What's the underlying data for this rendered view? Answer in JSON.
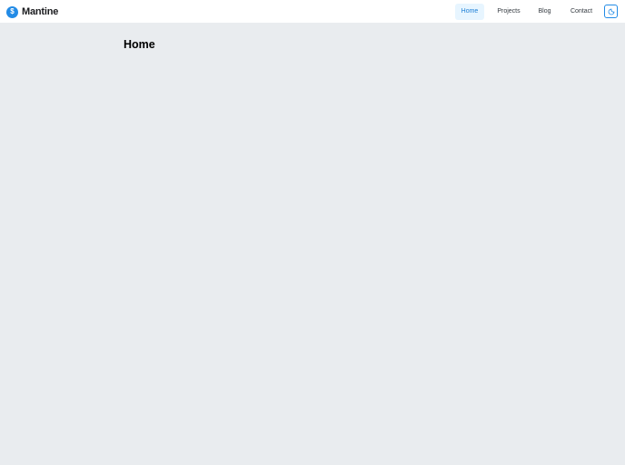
{
  "header": {
    "logo": {
      "mark_icon": "mantine-logo-icon",
      "brand_name": "Mantine"
    },
    "nav": {
      "items": [
        {
          "label": "Home",
          "active": true
        },
        {
          "label": "Projects",
          "active": false
        },
        {
          "label": "Blog",
          "active": false
        },
        {
          "label": "Contact",
          "active": false
        }
      ]
    },
    "theme_toggle": {
      "icon": "moon-icon"
    }
  },
  "main": {
    "title": "Home"
  },
  "colors": {
    "accent": "#228be6",
    "active_nav_bg": "#e7f5ff",
    "active_nav_text": "#1c7ed6",
    "page_bg": "#e9ecef",
    "header_bg": "#ffffff"
  }
}
